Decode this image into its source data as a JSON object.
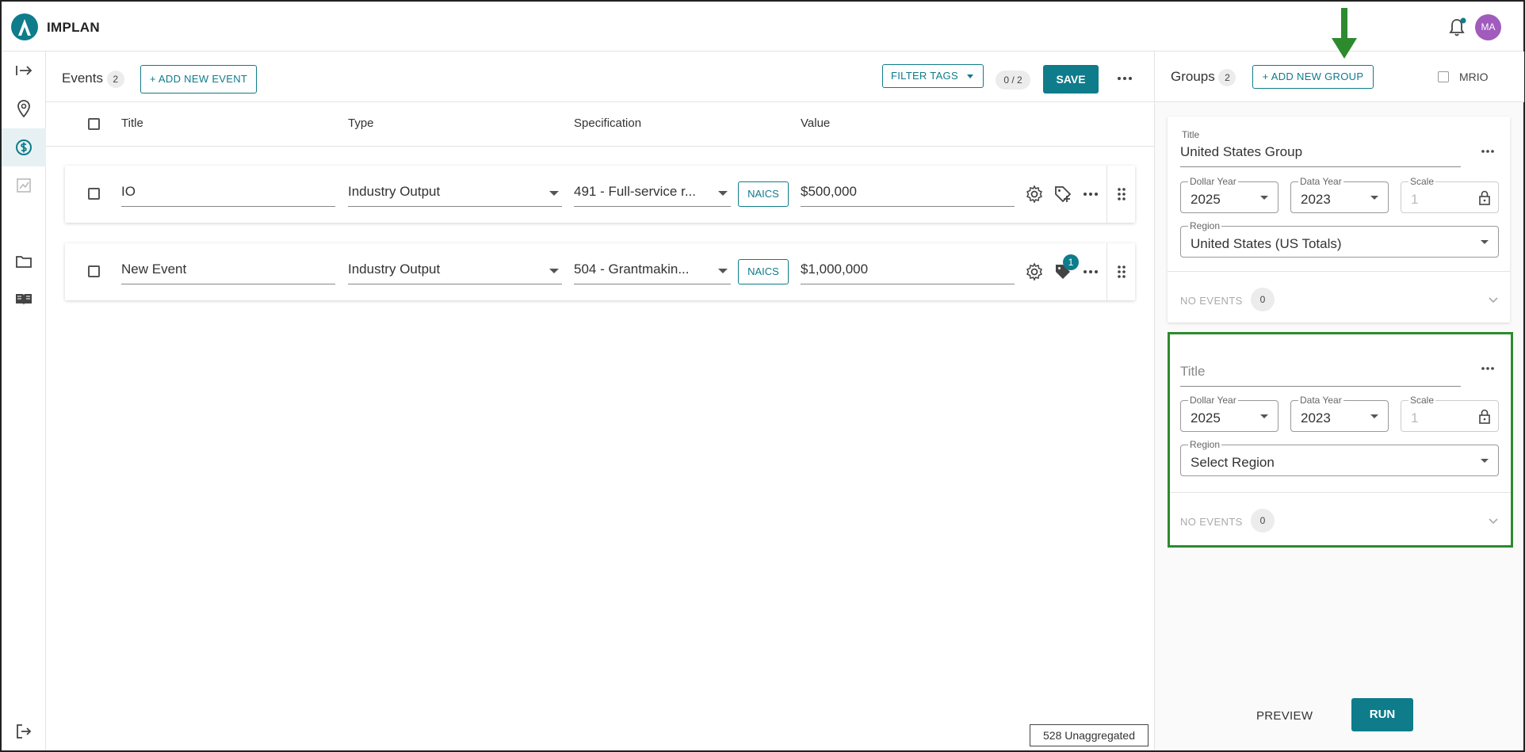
{
  "app": {
    "title": "IMPLAN",
    "user_initials": "MA"
  },
  "colors": {
    "accent": "#0e7c8a",
    "highlight": "#2d8a2d",
    "avatar": "#a05bbd"
  },
  "rail": {
    "icons": [
      "expand-icon",
      "location-icon",
      "dollar-icon",
      "chart-icon",
      "folder-icon",
      "book-icon",
      "logout-icon"
    ]
  },
  "events": {
    "title": "Events",
    "count": "2",
    "add_label": "+ ADD NEW EVENT",
    "filter_label": "FILTER TAGS",
    "selection_count": "0 / 2",
    "save_label": "SAVE",
    "columns": {
      "title": "Title",
      "type": "Type",
      "specification": "Specification",
      "value": "Value"
    },
    "rows": [
      {
        "title": "IO",
        "type": "Industry Output",
        "spec": "491 - Full-service r...",
        "naics": "NAICS",
        "value": "$500,000"
      },
      {
        "title": "New Event",
        "type": "Industry Output",
        "spec": "504 - Grantmakin...",
        "naics": "NAICS",
        "value": "$1,000,000",
        "tag_count": "1"
      }
    ],
    "unaggregated": "528 Unaggregated"
  },
  "groups": {
    "title": "Groups",
    "count": "2",
    "add_label": "+ ADD NEW GROUP",
    "mrio_label": "MRIO",
    "labels": {
      "title": "Title",
      "dollar_year": "Dollar Year",
      "data_year": "Data Year",
      "scale": "Scale",
      "region": "Region",
      "no_events": "NO EVENTS"
    },
    "cards": [
      {
        "title": "United States Group",
        "dollar_year": "2025",
        "data_year": "2023",
        "scale": "1",
        "region": "United States (US Totals)",
        "events": "0"
      },
      {
        "title_placeholder": "Title",
        "dollar_year": "2025",
        "data_year": "2023",
        "scale": "1",
        "region": "Select Region",
        "events": "0"
      }
    ],
    "preview_label": "PREVIEW",
    "run_label": "RUN"
  }
}
